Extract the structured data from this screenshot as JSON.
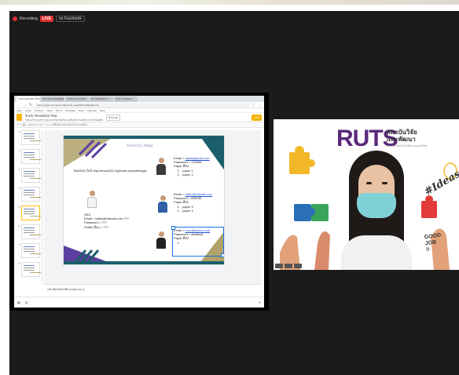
{
  "recording_bar": {
    "recording_label": "Recording",
    "live_label": "LIVE",
    "facebook_label": "on Facebook"
  },
  "browser": {
    "tabs": [
      "ระบบ Tess2022 โครง...",
      "GIS-SLIM MEMBER D...",
      "Profile | Tess2022",
      "ตรวจสอบผลการ...",
      "Open in Sheets"
    ],
    "url": "docs.google.com/presentation/d/1_tess2022/edit#slide=id.p",
    "bookmarks": [
      "Apps",
      "Gmail",
      "YouTube",
      "Maps",
      "RUTS",
      "Tess2022",
      "Drive",
      "Calendar",
      "Meet"
    ]
  },
  "slides_app": {
    "doc_title": "ระบบ Tess2022 Test",
    "menu": "ไฟล์ แก้ไข ดู แทรก รูปแบบ สไลด์ จัดเรียง เครื่องมือ ส่วนเสริม ความช่วยเหลือ",
    "share_label": "แชร์",
    "present_label": "นำเสนอ",
    "toolbar": "↶ ↷ 🖨 ⌕ 100% ▾   ▭ ▾  T  ⬚  ◯  ╱  ▾   พื้นหลัง   เลย์เอาต์ ▾   ธีม   ทรานซิชัน",
    "thumb_numbers": [
      "1",
      "2",
      "3",
      "4",
      "5",
      "6",
      "7",
      "8"
    ],
    "speaker_notes": "คลิกเพื่อเพิ่มบันทึกของผู้บรรยาย"
  },
  "slide": {
    "title": "Test2022 ข้อมูล",
    "url_text": "Test2022 ลิงก์ http://tess2022.org/index.php/site/login",
    "user_left": {
      "lines": [
        "SSO",
        "Email = bbbb@hotmail.com ???",
        "Password = ???",
        "Profile อื่นๆ = ???"
      ]
    },
    "user_1": {
      "email_prefix": "Email = ",
      "email": "aaaa@gmail.com",
      "lines": [
        "Password = 123456",
        "Paper ที่ส่ง",
        "    1.   paper 1",
        "    2.   paper 2"
      ]
    },
    "user_2": {
      "email_prefix": "Email = ",
      "email": "bbbb@hotmail.com",
      "lines": [
        "Password = 098765",
        "Paper ที่ส่ง",
        "    1.   paper 3",
        "    2.   paper 4"
      ]
    },
    "user_3": {
      "email_prefix": "Email = ",
      "email": "cccc@yahoo.com",
      "lines": [
        "Password = asdfasdf",
        "Paper ที่ส่ง",
        "    1."
      ]
    }
  },
  "video": {
    "brand": "RUTS",
    "brand_thai_1": "สถาบันวิจัย",
    "brand_thai_2": "และพัฒนา",
    "brand_sub": "มหาวิทยาลัยเทคโนโลยีราชมงคลศรีวิชัย",
    "ideas": "#Ideas",
    "good_job": [
      "GOOD",
      "JOB",
      "!!"
    ]
  },
  "colors": {
    "live_red": "#e03131",
    "slides_yellow": "#f4b400",
    "slide_purple": "#5b3fa0",
    "slide_gold": "#b1a26a",
    "slide_teal": "#1b5e6b",
    "mask_blue": "#7fd1d6",
    "brand_purple": "#5a2a7a"
  }
}
